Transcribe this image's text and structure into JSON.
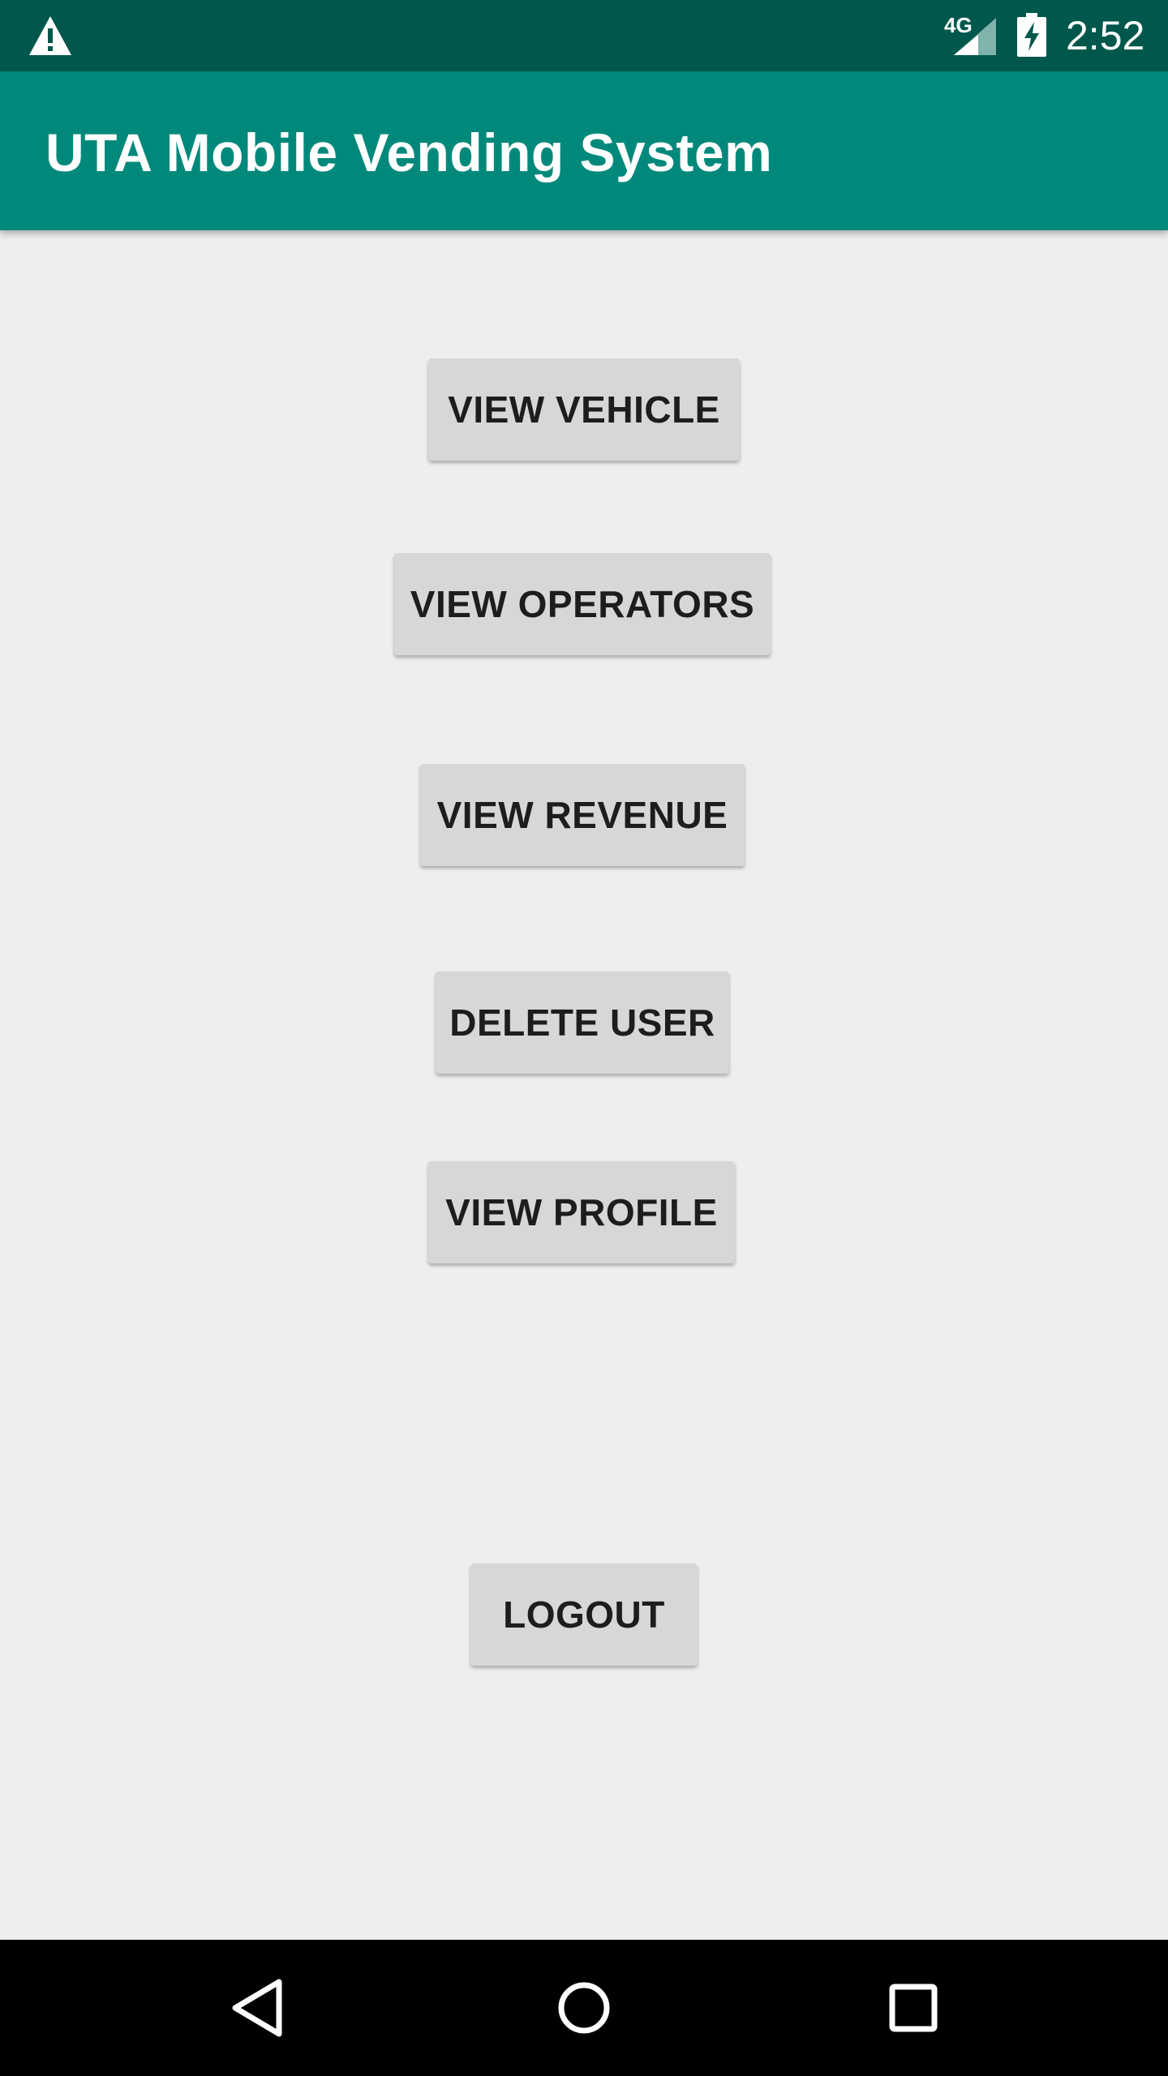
{
  "status_bar": {
    "network": "4G",
    "time": "2:52",
    "icons": [
      "warning-icon",
      "signal-icon",
      "battery-charging-icon"
    ]
  },
  "app_bar": {
    "title": "UTA Mobile Vending System"
  },
  "menu": {
    "view_vehicle": "VIEW VEHICLE",
    "view_operators": "VIEW OPERATORS",
    "view_revenue": "VIEW REVENUE",
    "delete_user": "DELETE USER",
    "view_profile": "VIEW PROFILE",
    "logout": "LOGOUT"
  },
  "nav_bar": {
    "icons": [
      "back-icon",
      "home-icon",
      "recents-icon"
    ]
  },
  "colors": {
    "status_bar": "#00574b",
    "app_bar": "#00897b",
    "background": "#eeeeee",
    "button": "#d6d7d7",
    "nav_bar": "#000000"
  }
}
